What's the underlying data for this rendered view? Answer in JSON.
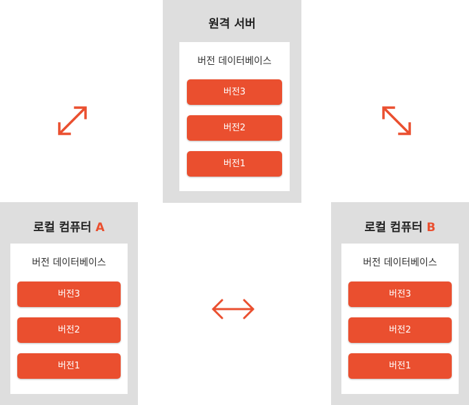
{
  "remote": {
    "title": "원격 서버",
    "db_title": "버전 데이터베이스",
    "versions": [
      "버전3",
      "버전2",
      "버전1"
    ]
  },
  "local_a": {
    "title": "로컬 컴퓨터",
    "suffix": "A",
    "db_title": "버전 데이터베이스",
    "versions": [
      "버전3",
      "버전2",
      "버전1"
    ]
  },
  "local_b": {
    "title": "로컬 컴퓨터",
    "suffix": "B",
    "db_title": "버전 데이터베이스",
    "versions": [
      "버전3",
      "버전2",
      "버전1"
    ]
  },
  "colors": {
    "accent": "#ea4f2f",
    "panel": "#dedede",
    "text": "#222222"
  }
}
